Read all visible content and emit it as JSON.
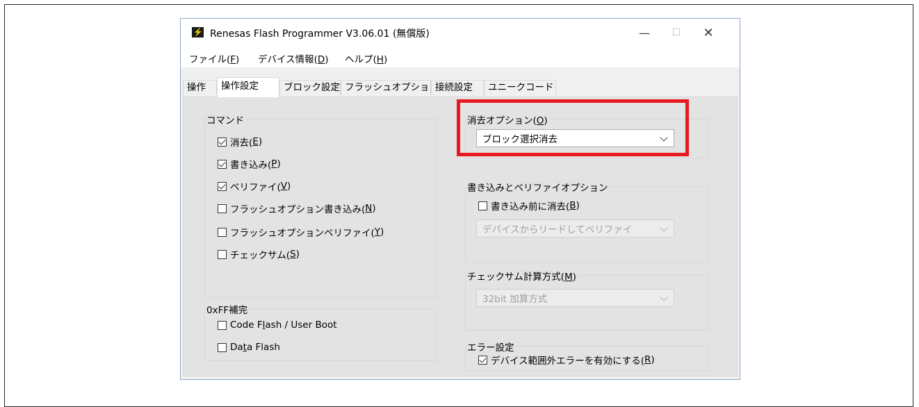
{
  "window": {
    "title": "Renesas Flash Programmer V3.06.01 (無償版)",
    "minimize": "—",
    "maximize": "☐",
    "close": "✕"
  },
  "menu": {
    "file": {
      "label": "ファイル(",
      "key": "F",
      "end": ")"
    },
    "device": {
      "label": "デバイス情報(",
      "key": "D",
      "end": ")"
    },
    "help": {
      "label": "ヘルプ(",
      "key": "H",
      "end": ")"
    }
  },
  "tabs": [
    "操作",
    "操作設定",
    "ブロック設定",
    "フラッシュオプション",
    "接続設定",
    "ユニークコード"
  ],
  "command_group": {
    "title": "コマンド",
    "items": [
      {
        "label": "消去(",
        "key": "E",
        "end": ")",
        "checked": true
      },
      {
        "label": "書き込み(",
        "key": "P",
        "end": ")",
        "checked": true
      },
      {
        "label": "ベリファイ(",
        "key": "V",
        "end": ")",
        "checked": true
      },
      {
        "label": "フラッシュオプション書き込み(",
        "key": "N",
        "end": ")",
        "checked": false
      },
      {
        "label": "フラッシュオプションベリファイ(",
        "key": "Y",
        "end": ")",
        "checked": false
      },
      {
        "label": "チェックサム(",
        "key": "S",
        "end": ")",
        "checked": false
      }
    ]
  },
  "fill_group": {
    "title": "0xFF補完",
    "items": [
      {
        "pre": "Code F",
        "key": "l",
        "post": "ash / User Boot",
        "checked": false
      },
      {
        "pre": "Da",
        "key": "t",
        "post": "a Flash",
        "checked": false
      }
    ]
  },
  "erase_group": {
    "title_pre": "消去オプション(",
    "title_key": "O",
    "title_end": ")",
    "selected": "ブロック選択消去"
  },
  "write_group": {
    "title": "書き込みとベリファイオプション",
    "checkbox": {
      "label": "書き込み前に消去(",
      "key": "B",
      "end": ")",
      "checked": false
    },
    "selected": "デバイスからリードしてベリファイ"
  },
  "checksum_group": {
    "title_pre": "チェックサム計算方式(",
    "title_key": "M",
    "title_end": ")",
    "selected": "32bit 加算方式"
  },
  "error_group": {
    "title": "エラー設定",
    "checkbox": {
      "label": "デバイス範囲外エラーを有効にする(",
      "key": "R",
      "end": ")",
      "checked": true
    }
  },
  "colors": {
    "highlight": "#e8191f",
    "accent": "#0078d7"
  }
}
